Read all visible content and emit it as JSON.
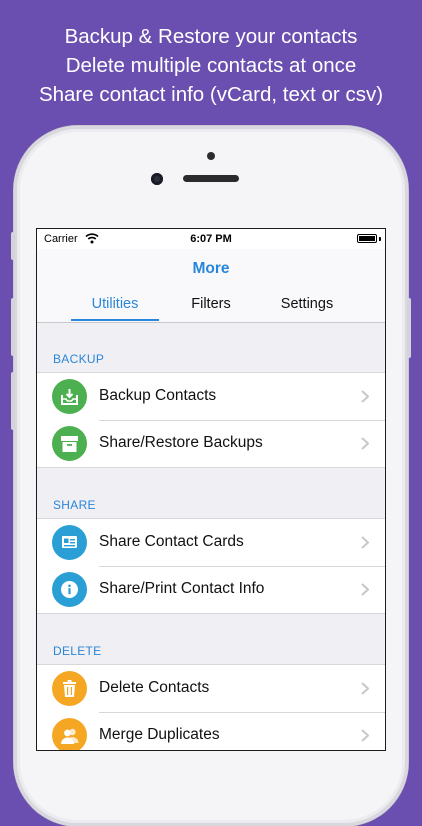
{
  "headline": {
    "line1": "Backup & Restore your contacts",
    "line2": "Delete multiple contacts at once",
    "line3": "Share contact info (vCard, text or csv)"
  },
  "status_bar": {
    "carrier": "Carrier",
    "time": "6:07 PM"
  },
  "nav": {
    "title": "More"
  },
  "tabs": [
    {
      "label": "Utilities",
      "active": true
    },
    {
      "label": "Filters",
      "active": false
    },
    {
      "label": "Settings",
      "active": false
    }
  ],
  "sections": [
    {
      "header": "BACKUP",
      "rows": [
        {
          "label": "Backup Contacts",
          "icon": "backup-tray-icon",
          "color": "#4caf50"
        },
        {
          "label": "Share/Restore Backups",
          "icon": "archive-box-icon",
          "color": "#4caf50"
        }
      ]
    },
    {
      "header": "SHARE",
      "rows": [
        {
          "label": "Share Contact Cards",
          "icon": "contact-card-icon",
          "color": "#2a9fd6"
        },
        {
          "label": "Share/Print Contact Info",
          "icon": "info-icon",
          "color": "#2a9fd6"
        }
      ]
    },
    {
      "header": "DELETE",
      "rows": [
        {
          "label": "Delete Contacts",
          "icon": "trash-icon",
          "color": "#f5a623"
        },
        {
          "label": "Merge Duplicates",
          "icon": "people-icon",
          "color": "#f5a623"
        }
      ]
    }
  ],
  "colors": {
    "background": "#6a4fb0",
    "accent": "#2a86d8"
  }
}
